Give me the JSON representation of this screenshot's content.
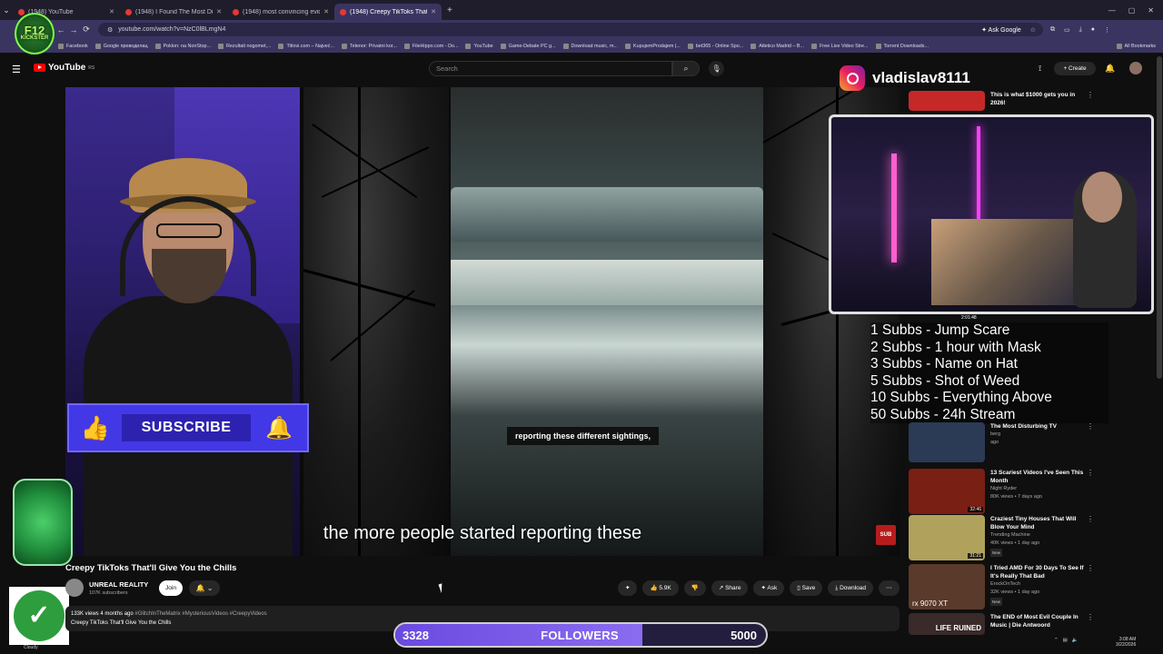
{
  "browser": {
    "tabs": [
      {
        "title": "(1948) YouTube",
        "active": false
      },
      {
        "title": "(1948) I Found The Most Disturb",
        "active": false
      },
      {
        "title": "(1948) most convincing eviden",
        "active": false
      },
      {
        "title": "(1948) Creepy TikToks That",
        "active": true
      }
    ],
    "url": "youtube.com/watch?v=NzC0lBLmgN4",
    "ask_google": "Ask Google",
    "bookmarks": [
      "Facebook",
      "Google преводилац",
      "Poklon: na NonStop...",
      "Rezultati nogomet,...",
      "Titlovi.com – Najveć...",
      "Telenor: Privatni kor...",
      "FileHippo.com - Do...",
      "YouTube",
      "Game-Debate PC g...",
      "Download music, m...",
      "KupujemProdajem |...",
      "bet365 - Online Spo...",
      "Atletico Madrid – B...",
      "Free Live Video Stre...",
      "Torrent Downloads..."
    ],
    "all_bookmarks": "All Bookmarks"
  },
  "logo": {
    "line1": "F12",
    "line2": "KICKSTER"
  },
  "youtube": {
    "brand": "YouTube",
    "region": "RS",
    "search_placeholder": "Search",
    "create_label": "Create",
    "notif_count": "9+"
  },
  "video": {
    "small_subtitle": "reporting these different sightings,",
    "caption": "the more people started reporting these",
    "sub_badge": "SUB",
    "title": "Creepy TikToks That'll Give You the Chills",
    "channel": "UNREAL REALITY",
    "subscribers": "107K subscribers",
    "join_label": "Join",
    "likes": "5.9K",
    "share_label": "Share",
    "ask_label": "Ask",
    "save_label": "Save",
    "download_label": "Download",
    "views_date": "133K views  4 months ago",
    "hashtags": "#GlitchInTheMatrix #MysteriousVideos #CreepyVideos",
    "description": "Creepy TikToks That'll Give You the Chills"
  },
  "overlay": {
    "subscribe_label": "SUBSCRIBE",
    "instagram": "vladislav8111",
    "cam_time": "2:01:48",
    "goals": [
      "1 Subbs - Jump Scare",
      "2 Subbs - 1 hour with Mask",
      "3 Subbs - Name on Hat",
      "5 Subbs - Shot of Weed",
      "10 Subbs - Everything Above",
      "50 Subbs - 24h Stream"
    ],
    "followers_current": "3328",
    "followers_label": "FOLLOWERS",
    "followers_goal": "5000",
    "followers_progress": 0.6656,
    "weather": "Cloudy"
  },
  "recommendations": [
    {
      "title": "This is what $1000 gets you in 2026!",
      "channel": "",
      "meta": "",
      "duration": "",
      "thumb_color": "#c62828",
      "new": false
    },
    {
      "title": "The Most Disturbing TV",
      "channel": "berg",
      "meta": "ago",
      "duration": "",
      "thumb_color": "#2b3a55",
      "new": false
    },
    {
      "title": "13 Scariest Videos I've Seen This Month",
      "channel": "Night Ryder",
      "meta": "80K views • 7 days ago",
      "duration": "32:46",
      "thumb_color": "#7a1f14",
      "new": false
    },
    {
      "title": "Craziest Tiny Houses That Will Blow Your Mind",
      "channel": "Trending Machine",
      "meta": "40K views • 1 day ago",
      "duration": "31:21",
      "thumb_color": "#b0a15c",
      "new": true
    },
    {
      "title": "I Tried AMD For 30 Days To See If It's Really That Bad",
      "channel": "ErockOnTech",
      "meta": "32K views • 1 day ago",
      "duration": "",
      "thumb_color": "#5a3a2a",
      "new": true
    },
    {
      "title": "The END of Most Evil Couple In Music | Die Antwoord",
      "channel": "",
      "meta": "",
      "duration": "",
      "thumb_color": "#3a2a2a",
      "new": false
    }
  ],
  "thumb_text": {
    "amd": "rx 9070 XT",
    "life": "LIFE RUINED"
  },
  "clock": {
    "time": "3:08 AM",
    "date": "3/22/2026"
  }
}
